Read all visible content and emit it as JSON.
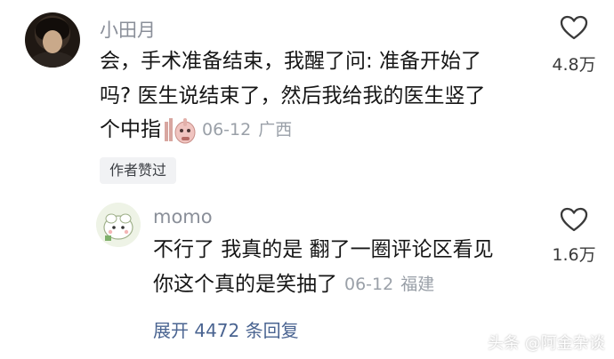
{
  "main_comment": {
    "username": "小田月",
    "lines": [
      "会，手术准备结束，我醒了问: 准备开始了",
      "吗? 医生说结束了，然后我给我的医生竖了",
      "个中指"
    ],
    "date": "06-12",
    "location": "广西",
    "likes": "4.8万",
    "author_liked_label": "作者赞过"
  },
  "reply": {
    "username": "momo",
    "lines": [
      "不行了 我真的是 翻了一圈评论区看见",
      "你这个真的是笑抽了"
    ],
    "date": "06-12",
    "location": "福建",
    "likes": "1.6万"
  },
  "expand_replies_label": "展开 4472 条回复",
  "watermark": "头条 @阿金杂谈",
  "icons": {
    "like": "heart-outline-icon",
    "emoji": "middle-finger-emoji-icon"
  },
  "colors": {
    "link_blue": "#4a6491",
    "meta_gray": "#9aa0a8"
  }
}
